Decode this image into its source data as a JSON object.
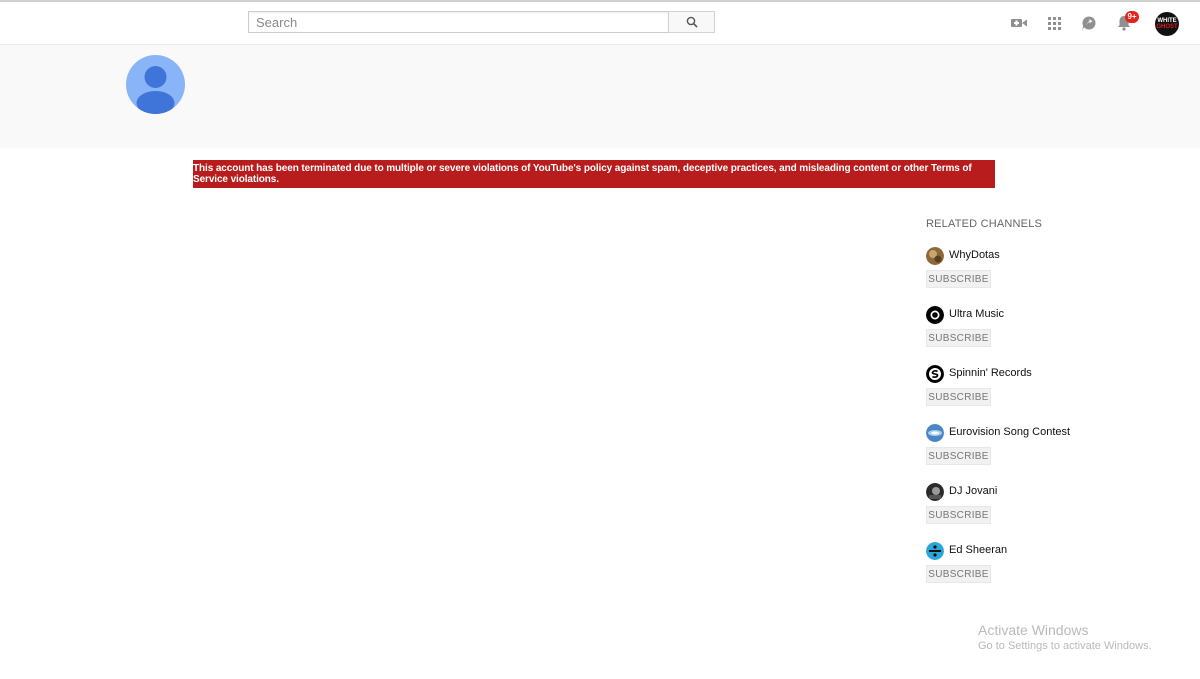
{
  "masthead": {
    "search": {
      "placeholder": "Search",
      "value": ""
    },
    "notifications_badge": "9+",
    "account": {
      "line1": "WHITE",
      "line2": "GHOST"
    }
  },
  "channel": {
    "termination_notice": "This account has been terminated due to multiple or severe violations of YouTube's policy against spam, deceptive practices, and misleading content or other Terms of Service violations."
  },
  "related": {
    "title": "RELATED CHANNELS",
    "subscribe_label": "SUBSCRIBE",
    "channels": [
      {
        "name": "WhyDotas"
      },
      {
        "name": "Ultra Music"
      },
      {
        "name": "Spinnin' Records"
      },
      {
        "name": "Eurovision Song Contest"
      },
      {
        "name": "DJ Jovani"
      },
      {
        "name": "Ed Sheeran"
      }
    ]
  },
  "watermark": {
    "line1": "Activate Windows",
    "line2": "Go to Settings to activate Windows."
  },
  "colors": {
    "alert": "#b81c1c",
    "badge": "#e62117",
    "avatar_bg": "#8ab4f8",
    "avatar_fg": "#3f74d8"
  }
}
